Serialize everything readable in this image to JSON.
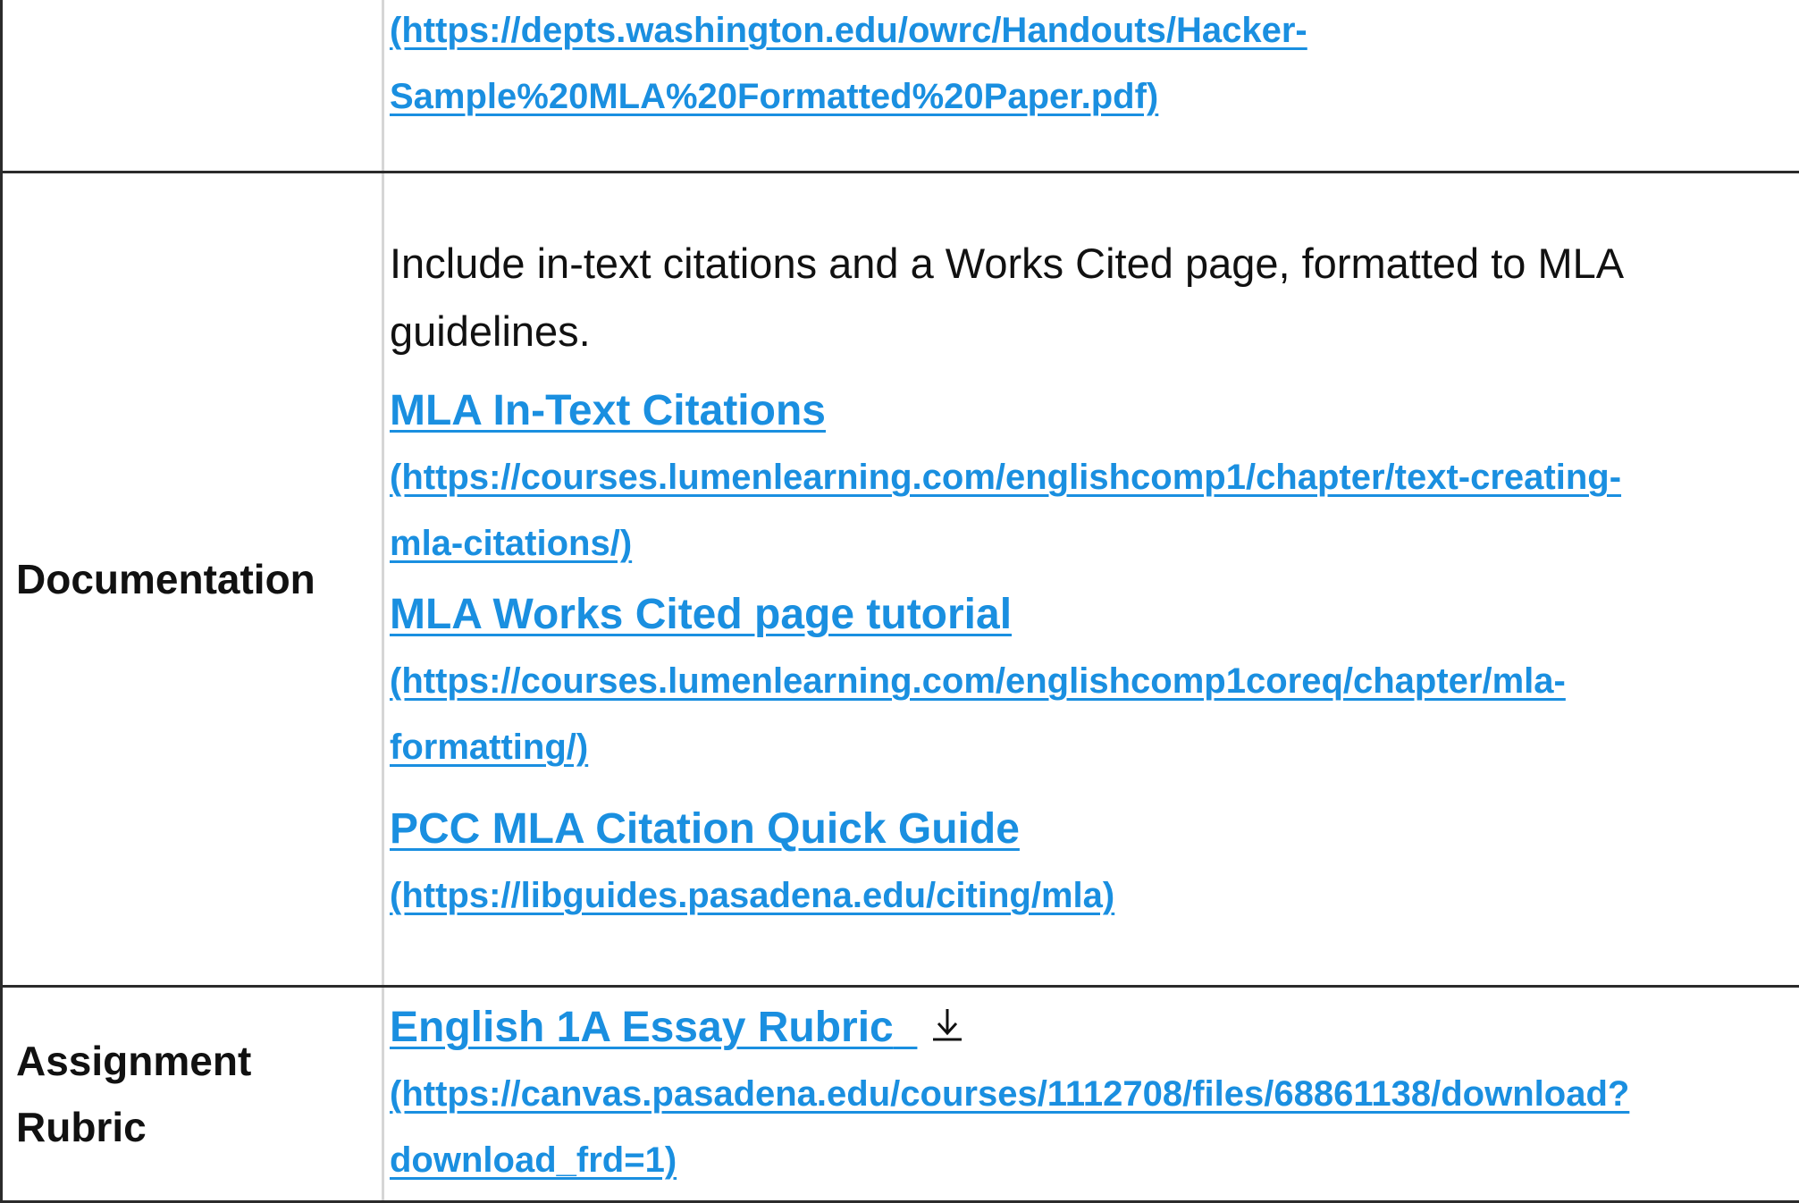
{
  "rows": {
    "top": {
      "url_line1": "(https://depts.washington.edu/owrc/Handouts/Hacker-",
      "url_line2": "Sample%20MLA%20Formatted%20Paper.pdf)"
    },
    "documentation": {
      "label": "Documentation",
      "intro_line1": "Include in-text citations and a Works Cited page, formatted to MLA",
      "intro_line2": "guidelines.",
      "links": [
        {
          "title": "MLA In-Text Citations",
          "url_line1": "(https://courses.lumenlearning.com/englishcomp1/chapter/text-creating-",
          "url_line2": "mla-citations/)"
        },
        {
          "title": "MLA Works Cited page tutorial",
          "url_line1": "(https://courses.lumenlearning.com/englishcomp1coreq/chapter/mla-",
          "url_line2": "formatting/)"
        },
        {
          "title": "PCC MLA Citation Quick Guide",
          "url_line1": "(https://libguides.pasadena.edu/citing/mla)"
        }
      ]
    },
    "rubric": {
      "label_line1": "Assignment",
      "label_line2": "Rubric",
      "title": "English 1A Essay Rubric",
      "icon": "download-icon",
      "url_line1": "(https://canvas.pasadena.edu/courses/1112708/files/68861138/download?",
      "url_line2": "download_frd=1)"
    }
  },
  "colors": {
    "link": "#1a8fe0",
    "text": "#111111",
    "border": "#2b2b2b",
    "inner_border": "#d6d6d6"
  }
}
